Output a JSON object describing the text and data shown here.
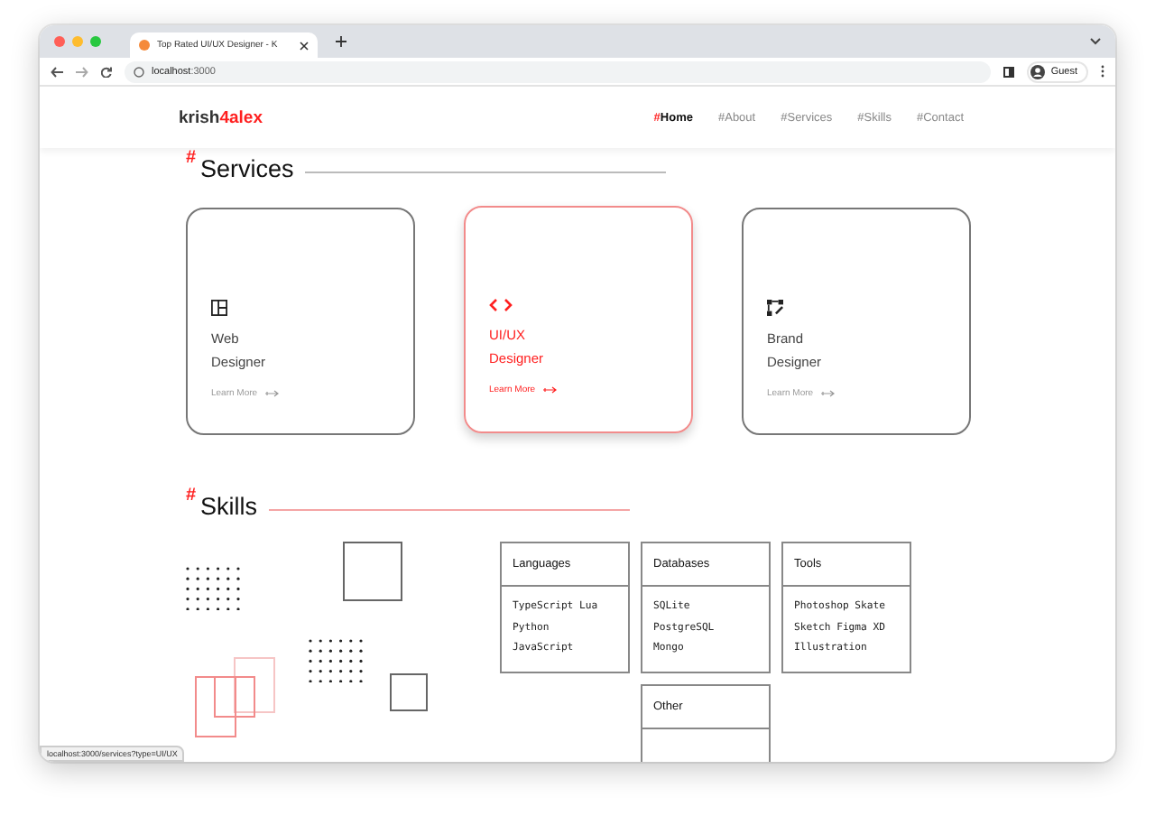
{
  "browser": {
    "tab_title": "Top Rated UI/UX Designer - K",
    "url_host": "localhost",
    "url_port": ":3000",
    "profile": "Guest"
  },
  "header": {
    "logo": {
      "part_1": "krish",
      "part_2": "4alex"
    },
    "nav": [
      {
        "hash": "#",
        "label": "Home",
        "selected": true
      },
      {
        "hash": "#",
        "label": "About",
        "selected": false
      },
      {
        "hash": "#",
        "label": "Services",
        "selected": false
      },
      {
        "hash": "#",
        "label": "Skills",
        "selected": false
      },
      {
        "hash": "#",
        "label": "Contact",
        "selected": false
      }
    ]
  },
  "services": {
    "hash": "#",
    "title": "Services",
    "cards": [
      {
        "kind": "layout",
        "title_1": "Web",
        "title_2": "Designer",
        "link": "Learn More",
        "selected": false
      },
      {
        "kind": "code",
        "title_1": "UI/UX",
        "title_2": "Designer",
        "link": "Learn More",
        "selected": true
      },
      {
        "kind": "brand",
        "title_1": "Brand",
        "title_2": "Designer",
        "link": "Learn More",
        "selected": false
      }
    ]
  },
  "skills": {
    "hash": "#",
    "title": "Skills",
    "groups": [
      {
        "title": "Languages",
        "lines": [
          "TypeScript Lua",
          "Python",
          "JavaScript"
        ]
      },
      {
        "title": "Databases",
        "lines": [
          "SQLite",
          "PostgreSQL",
          "Mongo"
        ]
      },
      {
        "title": "Tools",
        "lines": [
          "Photoshop Skate",
          "Sketch Figma XD",
          "Illustration"
        ]
      },
      {
        "title": "Other"
      }
    ]
  },
  "status_bar": "localhost:3000/services?type=UI/UX"
}
